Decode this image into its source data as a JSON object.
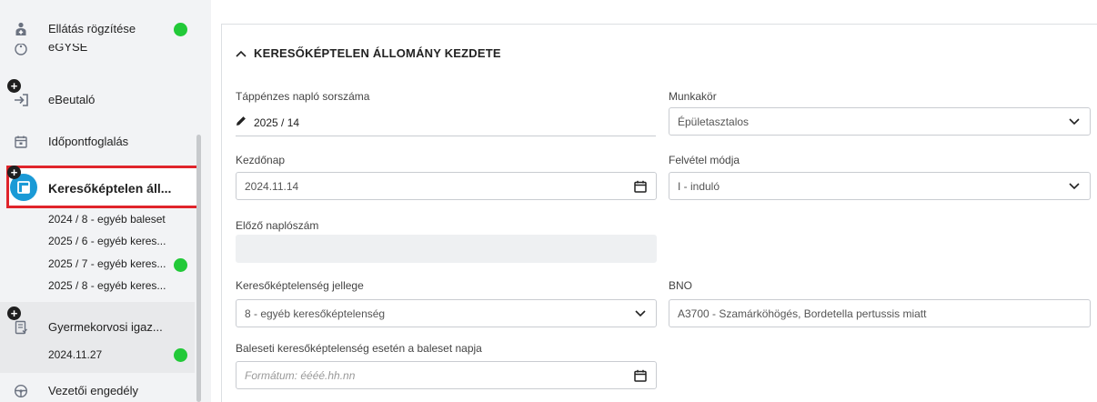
{
  "sidebar": {
    "items": [
      {
        "label": "Ellátás rögzítése",
        "icon": "person-medical-icon",
        "badge": "green"
      },
      {
        "label": "eGYSE",
        "icon": "accessibility-icon"
      },
      {
        "label": "eBeutaló",
        "icon": "referral-icon",
        "badge": "plus"
      },
      {
        "label": "Időpontfoglalás",
        "icon": "calendar-icon"
      },
      {
        "label": "Keresőképtelen áll...",
        "icon": "sick-leave-icon",
        "badge": "plus",
        "active": true
      },
      {
        "label": "Gyermekorvosi igaz...",
        "icon": "certificate-icon",
        "badge": "plus"
      },
      {
        "label": "Vezetői engedély",
        "icon": "steering-wheel-icon"
      }
    ],
    "sick_leave_children": [
      {
        "label": "2024 / 8 - egyéb baleset"
      },
      {
        "label": "2025 / 6 - egyéb keres..."
      },
      {
        "label": "2025 / 7 - egyéb keres...",
        "badge": "green"
      },
      {
        "label": "2025 / 8 - egyéb keres..."
      }
    ],
    "pediatric_children": [
      {
        "label": "2024.11.27",
        "badge": "green"
      }
    ]
  },
  "form": {
    "section_title": "KERESŐKÉPTELEN ÁLLOMÁNY KEZDETE",
    "fields": {
      "tappenz_label": "Táppénzes napló sorszáma",
      "tappenz_value": "2025 / 14",
      "munkakor_label": "Munkakör",
      "munkakor_value": "Épületasztalos",
      "kezdonap_label": "Kezdőnap",
      "kezdonap_value": "2024.11.14",
      "felvetel_label": "Felvétel módja",
      "felvetel_value": "I - induló",
      "elozo_label": "Előző naplószám",
      "elozo_value": "",
      "jelleg_label": "Keresőképtelenség jellege",
      "jelleg_value": "8 - egyéb keresőképtelenség",
      "bno_label": "BNO",
      "bno_value": "A3700 - Szamárköhögés, Bordetella pertussis miatt",
      "baleset_label": "Baleseti keresőképtelenség esetén a baleset napja",
      "baleset_placeholder": "Formátum: éééé.hh.nn"
    }
  },
  "colors": {
    "accent_blue": "#1a9ad6",
    "status_green": "#22c938",
    "highlight_red": "#e0242b"
  }
}
